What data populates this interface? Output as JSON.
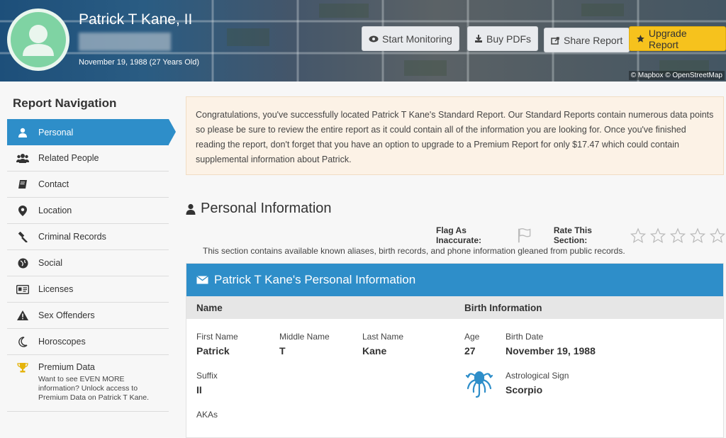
{
  "header": {
    "name": "Patrick T Kane, II",
    "dob_line": "November 19, 1988 (27 Years Old)",
    "buttons": {
      "monitor": "Start Monitoring",
      "pdf": "Buy PDFs",
      "share": "Share Report",
      "upgrade": "Upgrade Report"
    },
    "map_attribution": "© Mapbox © OpenStreetMap"
  },
  "sidebar": {
    "title": "Report Navigation",
    "items": [
      {
        "label": "Personal",
        "icon": "user-icon"
      },
      {
        "label": "Related People",
        "icon": "users-icon"
      },
      {
        "label": "Contact",
        "icon": "book-icon"
      },
      {
        "label": "Location",
        "icon": "map-pin-icon"
      },
      {
        "label": "Criminal Records",
        "icon": "gavel-icon"
      },
      {
        "label": "Social",
        "icon": "globe-icon"
      },
      {
        "label": "Licenses",
        "icon": "id-card-icon"
      },
      {
        "label": "Sex Offenders",
        "icon": "warning-icon"
      },
      {
        "label": "Horoscopes",
        "icon": "moon-icon"
      }
    ],
    "premium": {
      "label": "Premium Data",
      "desc": "Want to see EVEN MORE information? Unlock access to Premium Data on Patrick T Kane.",
      "icon": "trophy-icon"
    }
  },
  "alert": {
    "text": "Congratulations, you've successfully located Patrick T Kane's Standard Report. Our Standard Reports contain numerous data points so please be sure to review the entire report as it could contain all of the information you are looking for. Once you've finished reading the report, don't forget that you have an option to upgrade to a Premium Report for only $17.47 which could contain supplemental information about Patrick."
  },
  "section": {
    "title": "Personal Information",
    "flag_label": "Flag As Inaccurate:",
    "rate_label": "Rate This Section:",
    "description": "This section contains available known aliases, birth records, and phone information gleaned from public records."
  },
  "card": {
    "title": "Patrick T Kane's Personal Information",
    "name_header": "Name",
    "birth_header": "Birth Information",
    "first_name_label": "First Name",
    "first_name": "Patrick",
    "middle_name_label": "Middle Name",
    "middle_name": "T",
    "last_name_label": "Last Name",
    "last_name": "Kane",
    "suffix_label": "Suffix",
    "suffix": "II",
    "akas_label": "AKAs",
    "age_label": "Age",
    "age": "27",
    "birth_date_label": "Birth Date",
    "birth_date": "November 19, 1988",
    "sign_label": "Astrological Sign",
    "sign": "Scorpio"
  },
  "colors": {
    "accent": "#2e8ec9",
    "upgrade": "#f6c21d",
    "avatar": "#7fd3a3",
    "alert_bg": "#fcf2e6"
  }
}
